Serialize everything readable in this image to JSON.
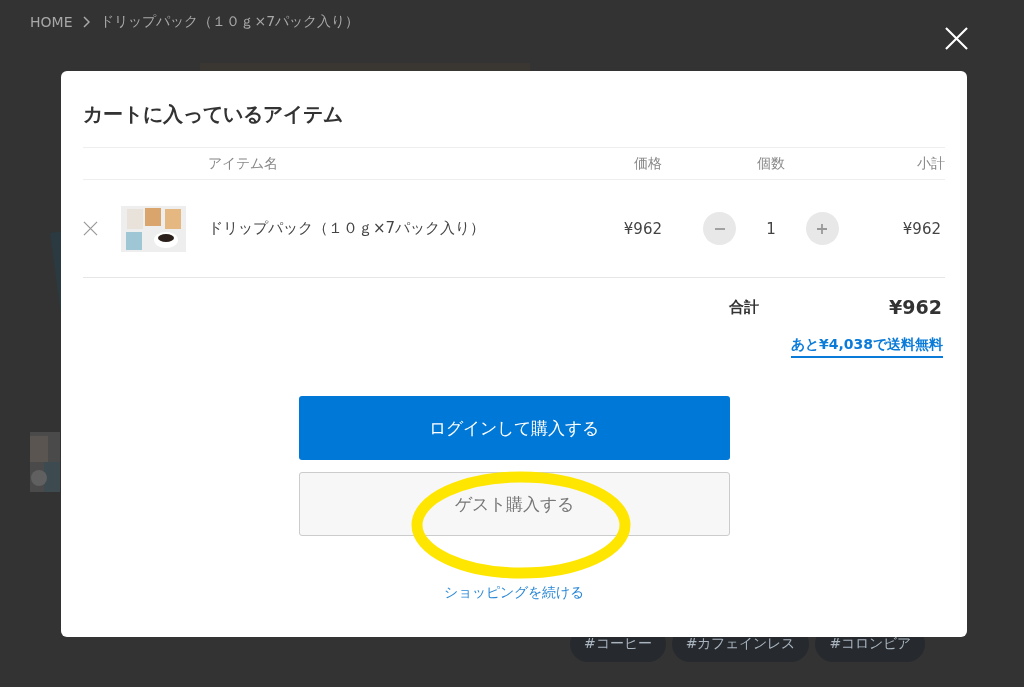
{
  "breadcrumb": [
    {
      "label": "HOME"
    },
    {
      "label": "ドリップパック（１０ｇ×7パック入り）"
    }
  ],
  "tags": [
    "#コーヒー",
    "#カフェインレス",
    "#コロンビア"
  ],
  "modal": {
    "title": "カートに入っているアイテム",
    "columns": [
      "アイテム名",
      "価格",
      "個数",
      "小計"
    ],
    "items": [
      {
        "name": "ドリップパック（１０ｇ×7パック入り）",
        "price": "¥962",
        "quantity": "1",
        "subtotal": "¥962"
      }
    ],
    "total_label": "合計",
    "total": "¥962",
    "free_shipping_link": "あと¥4,038で送料無料",
    "buttons": [
      {
        "label": "ログインして購入する",
        "kind": "primary"
      },
      {
        "label": "ゲスト購入する",
        "kind": "secondary"
      }
    ],
    "continue_link": "ショッピングを続ける"
  }
}
